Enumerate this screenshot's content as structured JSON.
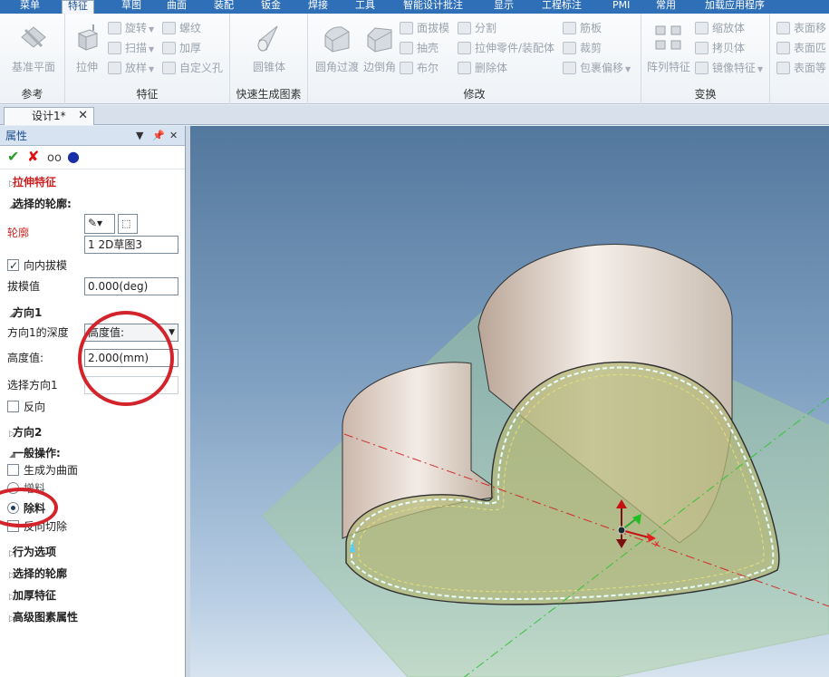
{
  "tabs": [
    "菜单",
    "特征",
    "草图",
    "曲面",
    "装配",
    "钣金",
    "焊接",
    "工具",
    "智能设计批注",
    "显示",
    "工程标注",
    "PMI",
    "常用",
    "加载应用程序"
  ],
  "ribbon": {
    "ref": {
      "datum": "基准平面",
      "label": "参考"
    },
    "feature": {
      "extrude": "拉伸",
      "revolve": "旋转",
      "sweep": "扫描",
      "loft": "放样",
      "thread": "螺纹",
      "thicken": "加厚",
      "custom_hole": "自定义孔",
      "label": "特征"
    },
    "quick": {
      "cone": "圆锥体",
      "label": "快速生成图素"
    },
    "modify": {
      "fillet": "圆角过渡",
      "chamfer": "边倒角",
      "face_draft": "面拔模",
      "shell": "抽壳",
      "boolean": "布尔",
      "split": "分割",
      "extrude_part": "拉伸零件/装配体",
      "delete_body": "删除体",
      "rib": "筋板",
      "trim": "裁剪",
      "wrap": "包裹偏移",
      "label": "修改"
    },
    "transform": {
      "pattern": "阵列特征",
      "scale": "缩放体",
      "copy": "拷贝体",
      "mirror": "镜像特征",
      "label": "变换"
    },
    "surface": {
      "move": "表面移",
      "match": "表面匹",
      "equal": "表面等"
    }
  },
  "document_tab": "设计1*",
  "panel": {
    "title": "属性",
    "feature_name": "拉伸特征",
    "select_profile": "选择的轮廓:",
    "profile_label": "轮廓",
    "profile_value": "1    2D草图3",
    "draft_inward": "向内拔模",
    "draft_checked": true,
    "draft_value_label": "拔模值",
    "draft_value": "0.000(deg)",
    "dir1": "方向1",
    "dir1_depth_label": "方向1的深度",
    "dir1_depth_value": "高度值:",
    "height_label": "高度值:",
    "height_value": "2.000(mm)",
    "select_dir1": "选择方向1",
    "reverse": "反向",
    "dir2": "方向2",
    "general_ops": "一般操作:",
    "gen_surface": "生成为曲面",
    "add_material": "增料",
    "remove_material": "除料",
    "reverse_cut": "反向切除",
    "behavior_options": "行为选项",
    "selected_profile": "选择的轮廓",
    "thicken_feature": "加厚特征",
    "advanced": "高级图素属性"
  },
  "colors": {
    "accent": "#2f6fb7",
    "annotation": "#d3232b",
    "required_label": "#cc1f1f"
  }
}
